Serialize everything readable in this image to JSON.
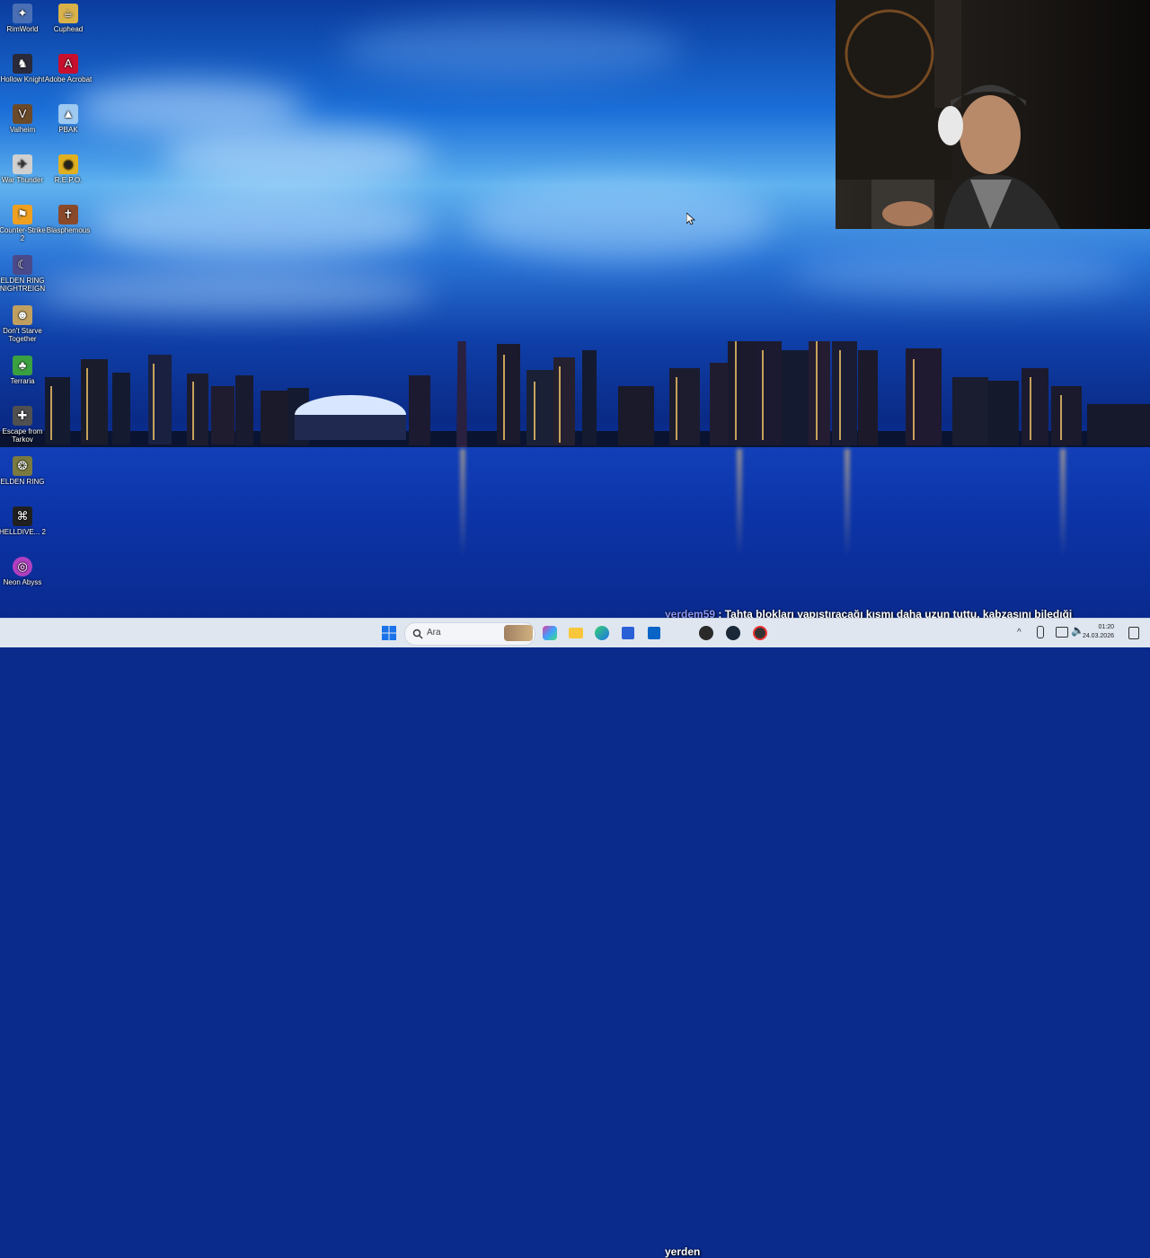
{
  "desktop_icons": [
    {
      "label": "RimWorld",
      "icon": "rimworld-icon",
      "color": "#4a6fb5"
    },
    {
      "label": "Cuphead",
      "icon": "cuphead-icon",
      "color": "#d9b24a"
    },
    {
      "label": "Hollow Knight",
      "icon": "hollow-knight-icon",
      "color": "#f0f0f0"
    },
    {
      "label": "Adobe Acrobat",
      "icon": "acrobat-icon",
      "color": "#c8102e"
    },
    {
      "label": "Valheim",
      "icon": "valheim-icon",
      "color": "#6b4a2a"
    },
    {
      "label": "PBAK",
      "icon": "pbak-icon",
      "color": "#9ec9f0"
    },
    {
      "label": "War Thunder",
      "icon": "war-thunder-icon",
      "color": "#d0d0d0"
    },
    {
      "label": "R.E.P.O.",
      "icon": "repo-icon",
      "color": "#e0b020"
    },
    {
      "label": "Counter-Strike 2",
      "icon": "counter-strike-icon",
      "color": "#f0a020"
    },
    {
      "label": "Blasphemous",
      "icon": "blasphemous-icon",
      "color": "#8a4a2a"
    },
    {
      "label": "ELDEN RING NIGHTREIGN",
      "icon": "elden-ring-nightreign-icon",
      "color": "#4a4a8a"
    },
    {
      "label": "Don't Starve Together",
      "icon": "dont-starve-icon",
      "color": "#c0a060"
    },
    {
      "label": "Terraria",
      "icon": "terraria-icon",
      "color": "#3aa040"
    },
    {
      "label": "Escape from Tarkov",
      "icon": "tarkov-icon",
      "color": "#505050"
    },
    {
      "label": "ELDEN RING",
      "icon": "elden-ring-icon",
      "color": "#7a7a40"
    },
    {
      "label": "HELLDIVE... 2",
      "icon": "helldivers-icon",
      "color": "#202020"
    },
    {
      "label": "Neon Abyss",
      "icon": "neon-abyss-icon",
      "color": "#b040c0"
    }
  ],
  "taskbar": {
    "search_placeholder": "Ara",
    "clock_time": "01:20",
    "clock_date": "24.03.2026"
  },
  "chat": {
    "user": "yerdem59",
    "separator": ":",
    "message": "Tahta blokları yapıştıracağı kısmı daha uzun tuttu, kabzasını biledıği",
    "user2": "yerden"
  },
  "colors": {
    "taskbar_bg": "#dfe6f0",
    "chat_user": "#8a98ff",
    "windows_blue": "#1a73e8"
  }
}
